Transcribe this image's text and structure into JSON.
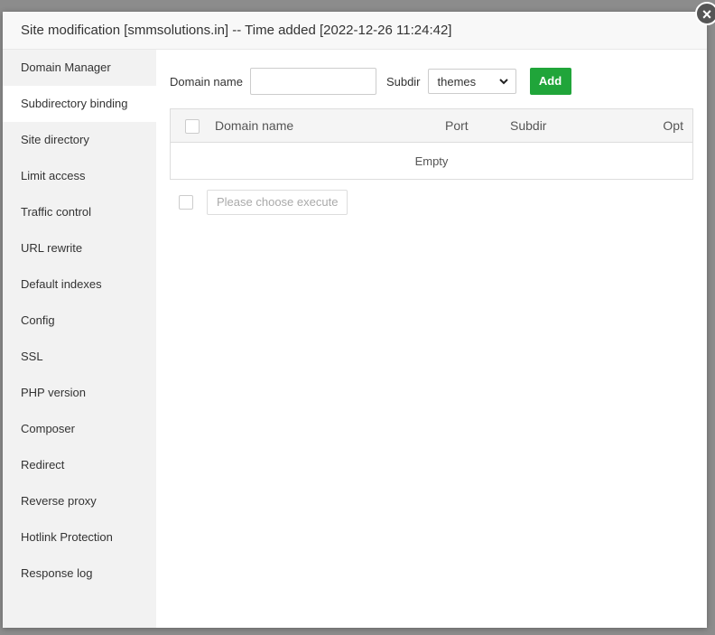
{
  "dialog": {
    "title": "Site modification [smmsolutions.in] -- Time added [2022-12-26 11:24:42]",
    "close_icon": "×"
  },
  "sidebar": {
    "items": [
      {
        "label": "Domain Manager"
      },
      {
        "label": "Subdirectory binding",
        "active": true
      },
      {
        "label": "Site directory"
      },
      {
        "label": "Limit access"
      },
      {
        "label": "Traffic control"
      },
      {
        "label": "URL rewrite"
      },
      {
        "label": "Default indexes"
      },
      {
        "label": "Config"
      },
      {
        "label": "SSL"
      },
      {
        "label": "PHP version"
      },
      {
        "label": "Composer"
      },
      {
        "label": "Redirect"
      },
      {
        "label": "Reverse proxy"
      },
      {
        "label": "Hotlink Protection"
      },
      {
        "label": "Response log"
      }
    ]
  },
  "form": {
    "domain_label": "Domain name",
    "domain_value": "",
    "subdir_label": "Subdir",
    "subdir_value": "themes",
    "add_label": "Add"
  },
  "table": {
    "headers": [
      "Domain name",
      "Port",
      "Subdir",
      "Opt"
    ],
    "empty_text": "Empty"
  },
  "footer": {
    "execute_placeholder": "Please choose execute"
  },
  "colors": {
    "accent": "#20a53a"
  }
}
